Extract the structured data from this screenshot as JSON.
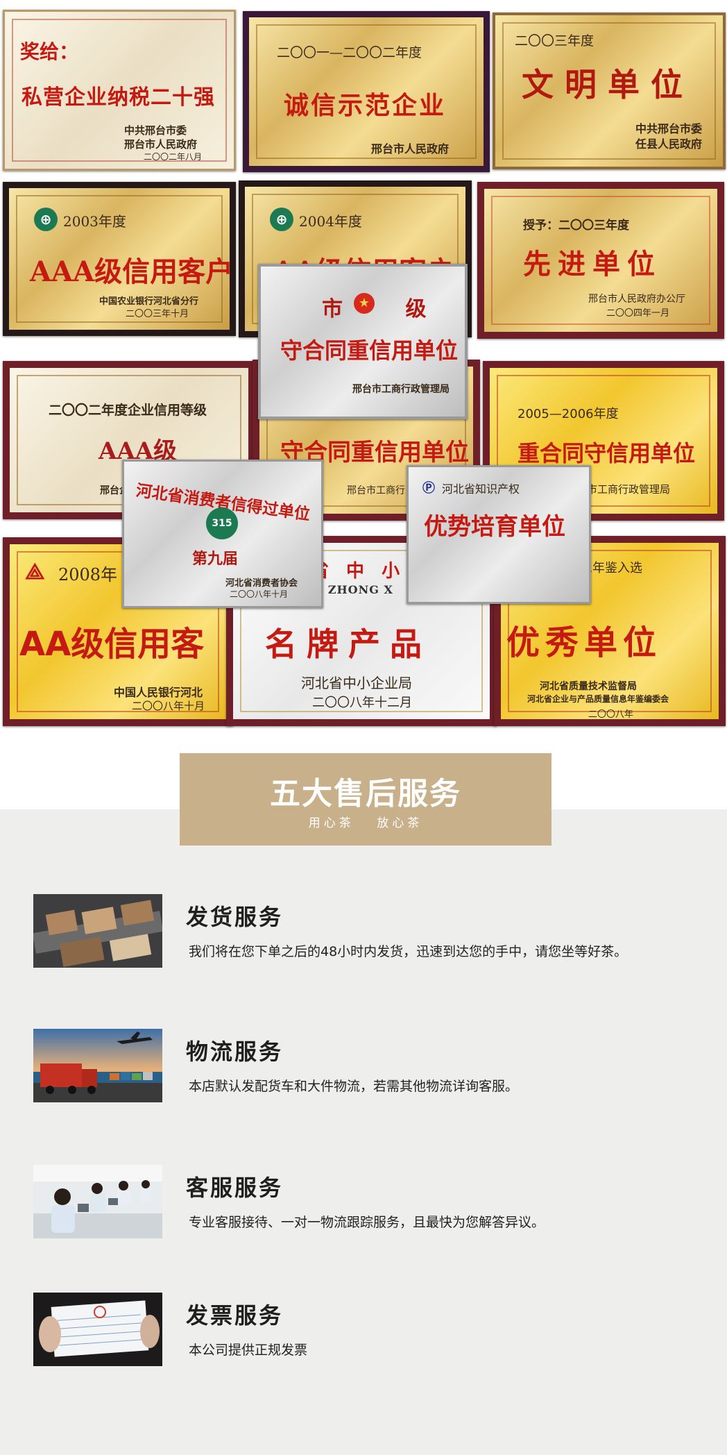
{
  "plaques": {
    "p1": {
      "line1": "奖给：",
      "line2": "私营企业纳税二十强",
      "line3": "中共邢台市委",
      "line4": "邢台市人民政府",
      "line5": "二〇〇二年八月"
    },
    "p2": {
      "line1": "二〇〇一—二〇〇二年度",
      "line2": "诚信示范企业",
      "line3": "邢台市人民政府"
    },
    "p3": {
      "line1": "二〇〇三年度",
      "line2": "文明单位",
      "line3": "中共邢台市委",
      "line4": "任县人民政府"
    },
    "p4": {
      "line1": "2003年度",
      "line2": "AAA级信用客户",
      "line3": "中国农业银行河北省分行",
      "line4": "二〇〇三年十月"
    },
    "p5": {
      "line1": "2004年度",
      "line2": "AA级信用客户"
    },
    "p6": {
      "line1": "授予：二〇〇三年度",
      "line2": "先进单位",
      "line3": "邢台市人民政府办公厅",
      "line4": "二〇〇四年一月"
    },
    "p7": {
      "line1": "市 级",
      "line2": "守合同重信用单位",
      "line3": "邢台市工商行政管理局"
    },
    "p8": {
      "line1": "二〇〇二年度企业信用等级",
      "line2": "AAA级",
      "line3": "邢台企"
    },
    "p9": {
      "line2": "守合同重信用单位",
      "line3": "邢台市工商行"
    },
    "p10": {
      "line1": "2005—2006年度",
      "line2": "重合同守信用单位",
      "line3": "邢台市工商行政管理局"
    },
    "p11": {
      "line1": "河北省消费者信得过单位",
      "line2": "第九届",
      "line3": "河北省消费者协会",
      "line4": "二〇〇八年十月",
      "emblem": "315"
    },
    "p12": {
      "line1": "河北省知识产权",
      "line2": "优势培育单位"
    },
    "p13": {
      "line1": "2008年",
      "line2": "AA级信用客",
      "line3": "中国人民银行河北",
      "line4": "二〇〇八年十月"
    },
    "p14": {
      "line1": "省 中 小",
      "line1b": "NG ZHONG X",
      "line2": "名牌产品",
      "line3": "河北省中小企业局",
      "line4": "二〇〇八年十二月"
    },
    "p15": {
      "line1": "质量信息年鉴入选",
      "line2": "优秀单位",
      "line3": "河北省质量技术监督局",
      "line4": "河北省企业与产品质量信息年鉴编委会",
      "line5": "二〇〇八年"
    }
  },
  "banner": {
    "title": "五大售后服务",
    "subtitle": "用心茶 放心茶"
  },
  "services": [
    {
      "title": "发货服务",
      "desc": "我们将在您下单之后的48小时内发货，迅速到达您的手中，请您坐等好茶。"
    },
    {
      "title": "物流服务",
      "desc": "本店默认发配货车和大件物流，若需其他物流详询客服。"
    },
    {
      "title": "客服服务",
      "desc": "专业客服接待、一对一物流跟踪服务，且最快为您解答异议。"
    },
    {
      "title": "发票服务",
      "desc": "本公司提供正规发票"
    }
  ],
  "colors": {
    "frame": "#6e1f28",
    "banner": "#c7b08a",
    "section_bg": "#eeeeec",
    "plaque_red": "#c41a12"
  }
}
